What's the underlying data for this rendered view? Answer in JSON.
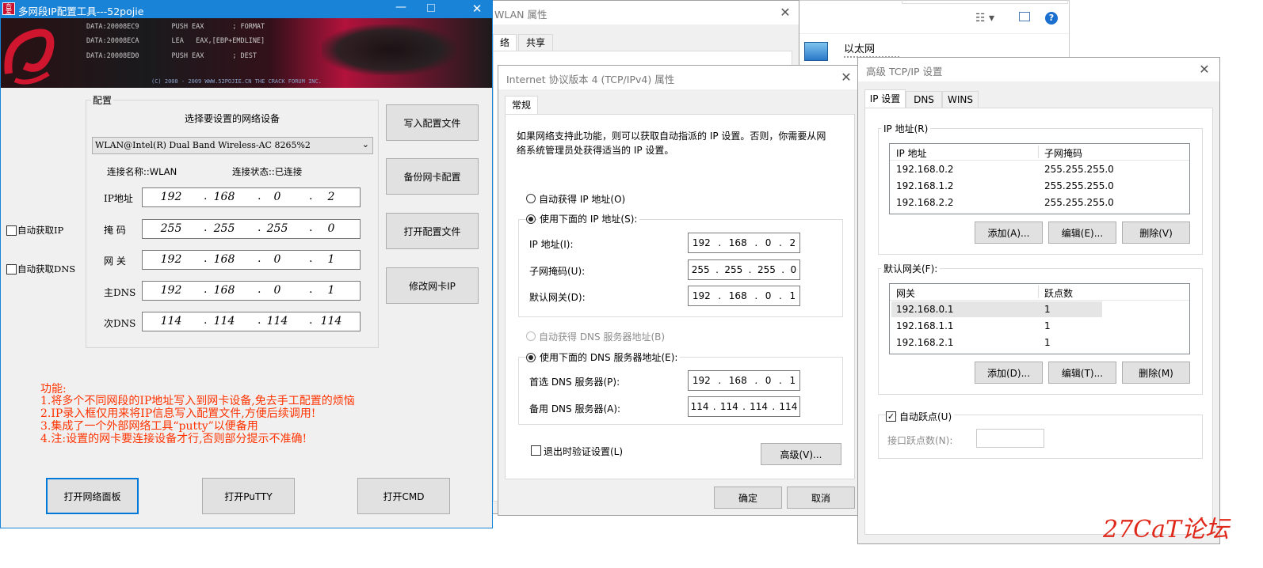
{
  "explorer": {
    "eth_name": "以太网"
  },
  "wlan": {
    "title": "WLAN 属性",
    "tab_left": "络",
    "tab_share": "共享"
  },
  "tcpip": {
    "title": "Internet 协议版本 4 (TCP/IPv4) 属性",
    "tab_general": "常规",
    "desc_line1": "如果网络支持此功能，则可以获取自动指派的 IP 设置。否则，你需要从网",
    "desc_line2": "络系统管理员处获得适当的 IP 设置。",
    "auto_ip": "自动获得 IP 地址(O)",
    "use_ip": "使用下面的 IP 地址(S):",
    "ip_label": "IP 地址(I):",
    "ip": [
      "192",
      "168",
      "0",
      "2"
    ],
    "mask_label": "子网掩码(U):",
    "mask": [
      "255",
      "255",
      "255",
      "0"
    ],
    "gw_label": "默认网关(D):",
    "gw": [
      "192",
      "168",
      "0",
      "1"
    ],
    "auto_dns": "自动获得 DNS 服务器地址(B)",
    "use_dns": "使用下面的 DNS 服务器地址(E):",
    "pdns_label": "首选 DNS 服务器(P):",
    "pdns": [
      "192",
      "168",
      "0",
      "1"
    ],
    "adns_label": "备用 DNS 服务器(A):",
    "adns": [
      "114",
      "114",
      "114",
      "114"
    ],
    "validate": "退出时验证设置(L)",
    "advanced": "高级(V)...",
    "ok": "确定",
    "cancel": "取消"
  },
  "advanced": {
    "title": "高级 TCP/IP 设置",
    "tabs": [
      "IP 设置",
      "DNS",
      "WINS"
    ],
    "ip_group": "IP 地址(R)",
    "ip_col1": "IP 地址",
    "ip_col2": "子网掩码",
    "ip_rows": [
      {
        "ip": "192.168.0.2",
        "mask": "255.255.255.0"
      },
      {
        "ip": "192.168.1.2",
        "mask": "255.255.255.0"
      },
      {
        "ip": "192.168.2.2",
        "mask": "255.255.255.0"
      }
    ],
    "add1": "添加(A)...",
    "edit1": "编辑(E)...",
    "del1": "删除(V)",
    "gw_group": "默认网关(F):",
    "gw_col1": "网关",
    "gw_col2": "跃点数",
    "gw_rows": [
      {
        "gw": "192.168.0.1",
        "metric": "1"
      },
      {
        "gw": "192.168.1.1",
        "metric": "1"
      },
      {
        "gw": "192.168.2.1",
        "metric": "1"
      }
    ],
    "add2": "添加(D)...",
    "edit2": "编辑(T)...",
    "del2": "删除(M)",
    "auto_metric": "自动跃点(U)",
    "iface_metric": "接口跃点数(N):"
  },
  "tool": {
    "title": "多网段IP配置工具---52pojie",
    "banner_lines": [
      "DATA:20008EC9        PUSH EAX       ; FORMAT",
      "DATA:20008ECA        LEA   EAX,[EBP+EMDLINE]",
      "DATA:20008ED0        PUSH EAX       ; DEST"
    ],
    "banner_footer": "(C) 2008 - 2009 WWW.52POJIE.CN  THE CRACK FORUM INC.",
    "group_title": "配置",
    "select_label": "选择要设置的网络设备",
    "adapter": "WLAN@Intel(R) Dual Band Wireless-AC 8265%2",
    "conn_name": "连接名称::WLAN",
    "conn_status": "连接状态::已连接",
    "ip_label": "IP地址",
    "mask_label": "掩 码",
    "gw_label": "网 关",
    "dns1_label": "主DNS",
    "dns2_label": "次DNS",
    "ip": [
      "192",
      "168",
      "0",
      "2"
    ],
    "mask": [
      "255",
      "255",
      "255",
      "0"
    ],
    "gw": [
      "192",
      "168",
      "0",
      "1"
    ],
    "dns1": [
      "192",
      "168",
      "0",
      "1"
    ],
    "dns2": [
      "114",
      "114",
      "114",
      "114"
    ],
    "auto_ip": "自动获取IP",
    "auto_dns": "自动获取DNS",
    "btn_write": "写入配置文件",
    "btn_backup": "备份网卡配置",
    "btn_open": "打开配置文件",
    "btn_modify": "修改网卡IP",
    "notes": [
      "功能:",
      "1.将多个不同网段的IP地址写入到网卡设备,免去手工配置的烦恼",
      "2.IP录入框仅用来将IP信息写入配置文件,方便后续调用!",
      "3.集成了一个外部网络工具“putty”以便备用",
      "4.注:设置的网卡要连接设备才行,否则部分提示不准确!"
    ],
    "btn_net": "打开网络面板",
    "btn_putty": "打开PuTTY",
    "btn_cmd": "打开CMD"
  },
  "watermark": "27CaT论坛"
}
